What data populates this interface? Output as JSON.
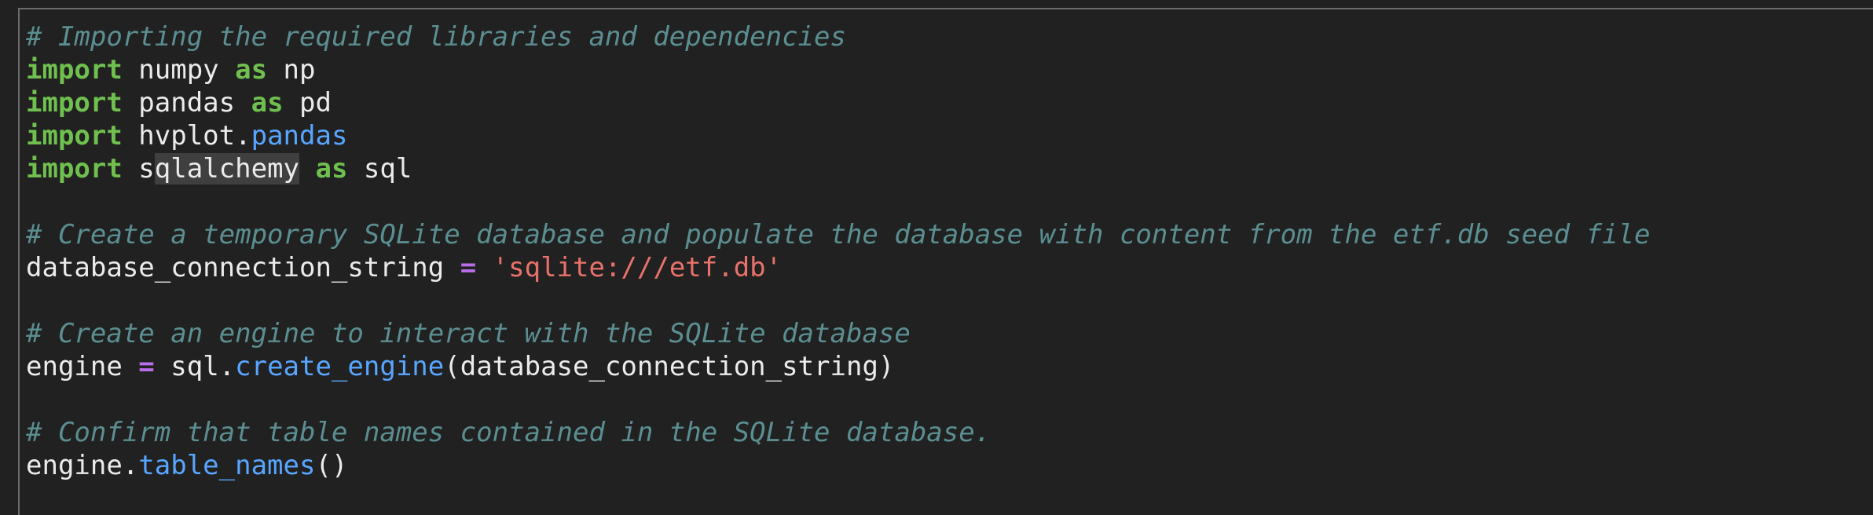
{
  "colors": {
    "background": "#212121",
    "comment": "#5b8e91",
    "keyword": "#6fc04e",
    "function": "#58a6ff",
    "string": "#e8726b",
    "operator": "#b96de9",
    "text": "#ebebeb",
    "highlight": "#3f3f3f"
  },
  "code": {
    "line1": "# Importing the required libraries and dependencies",
    "line2": {
      "kw": "import",
      "mod": " numpy ",
      "as": "as",
      "alias": " np"
    },
    "line3": {
      "kw": "import",
      "mod": " pandas ",
      "as": "as",
      "alias": " pd"
    },
    "line4": {
      "kw": "import",
      "mod": " hvplot.",
      "sub": "pandas"
    },
    "line5": {
      "kw": "import",
      "pre": " s",
      "hl": "qlalchemy",
      "post": " ",
      "as": "as",
      "alias": " sql"
    },
    "line7": "# Create a temporary SQLite database and populate the database with content from the etf.db seed file",
    "line8": {
      "var": "database_connection_string ",
      "op": "=",
      "sp": " ",
      "str": "'sqlite:///etf.db'"
    },
    "line10": "# Create an engine to interact with the SQLite database",
    "line11": {
      "var": "engine ",
      "op": "=",
      "obj": " sql.",
      "fn": "create_engine",
      "args": "(database_connection_string)"
    },
    "line13": "# Confirm that table names contained in the SQLite database.",
    "line14": {
      "obj": "engine.",
      "fn": "table_names",
      "args": "()"
    }
  }
}
